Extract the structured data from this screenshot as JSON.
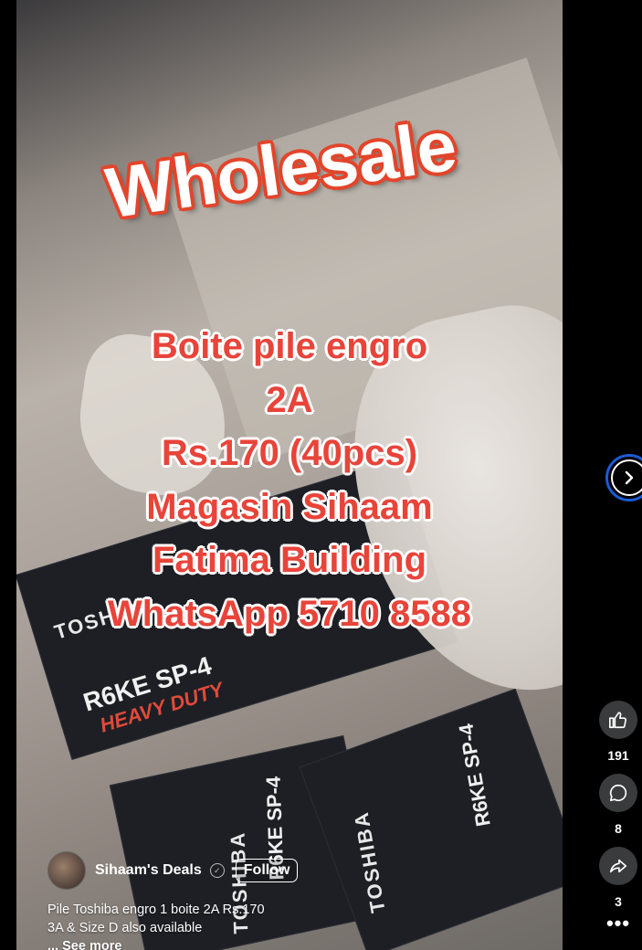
{
  "video": {
    "headline": "Wholesale",
    "overlay_lines": [
      "Boite pile engro",
      "2A",
      "Rs.170 (40pcs)",
      "Magasin Sihaam",
      "Fatima Building",
      "WhatsApp 5710 8588"
    ],
    "box_brand": "TOSHIBA",
    "box_model": "R6KE SP-4",
    "box_duty": "HEAVY DUTY"
  },
  "author": {
    "name": "Sihaam's Deals",
    "follow_label": "Follow"
  },
  "caption": {
    "line1": "Pile Toshiba engro 1 boite 2A Rs.170",
    "line2": "3A & Size D also available",
    "see_more": "... See more"
  },
  "actions": {
    "likes": "191",
    "comments": "8",
    "shares": "3"
  },
  "icons": {
    "like": "thumbs-up-icon",
    "comment": "comment-icon",
    "share": "share-icon",
    "more": "more-dots-icon",
    "next": "chevron-right-icon",
    "verified": "verified-icon"
  },
  "colors": {
    "background": "#000000",
    "overlay_text_red": "#e8443a",
    "action_circle": "#3a3b3c",
    "focus_ring": "#1b5bd6"
  }
}
